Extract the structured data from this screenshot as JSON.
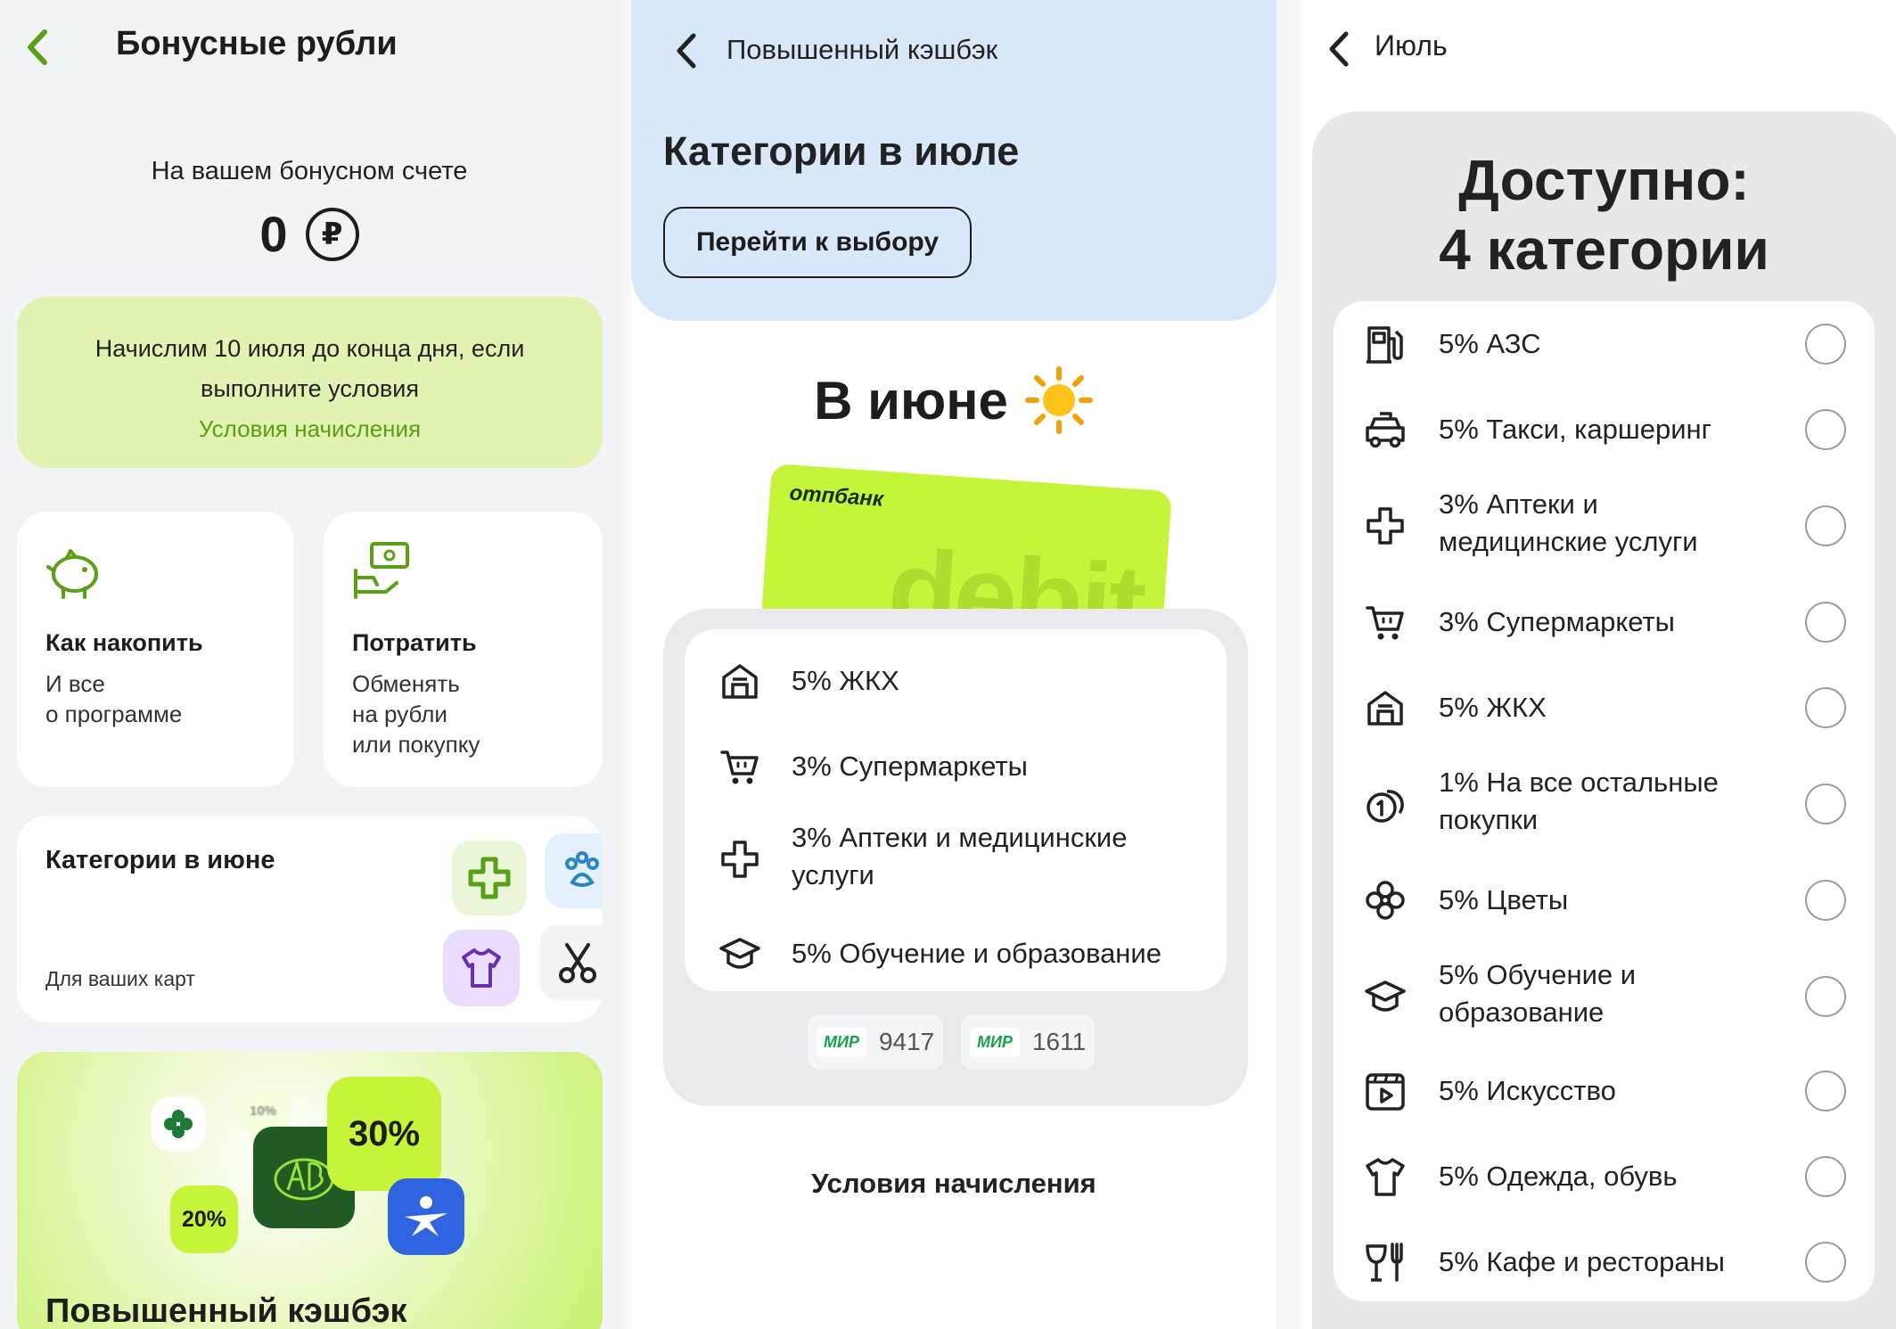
{
  "screen1": {
    "title": "Бонусные рубли",
    "balance_label": "На вашем бонусном счете",
    "balance_value": "0",
    "currency_symbol": "₽",
    "notice_line1": "Начислим 10 июля до конца дня, если",
    "notice_line2": "выполните условия",
    "notice_link": "Условия начисления",
    "card_accumulate": {
      "title": "Как накопить",
      "subtitle": "И все\nо программе",
      "icon": "piggy-bank-icon"
    },
    "card_spend": {
      "title": "Потратить",
      "subtitle": "Обменять\nна рубли\nили покупку",
      "icon": "cash-hand-icon"
    },
    "categories_card": {
      "title": "Категории в июне",
      "subtitle": "Для ваших карт"
    },
    "promo": {
      "badge_30": "30%",
      "badge_20": "20%",
      "badge_10": "10%",
      "title": "Повышенный кэшбэк"
    }
  },
  "screen2": {
    "title": "Повышенный кэшбэк",
    "heading": "Категории в июле",
    "choose_button": "Перейти к выбору",
    "june_title": "В июне",
    "card_brand": "отпбанк",
    "card_word": "debit",
    "june_items": [
      {
        "text": "5% ЖКХ",
        "icon": "house-icon"
      },
      {
        "text": "3% Супермаркеты",
        "icon": "cart-icon"
      },
      {
        "text": "3% Аптеки и медицинские\nуслуги",
        "icon": "cross-icon"
      },
      {
        "text": "5% Обучение и образование",
        "icon": "graduation-cap-icon"
      }
    ],
    "cards": [
      {
        "brand": "МИР",
        "number": "9417"
      },
      {
        "brand": "МИР",
        "number": "1611"
      }
    ],
    "conditions_link": "Условия начисления"
  },
  "screen3": {
    "title": "Июль",
    "available_line1": "Доступно:",
    "available_line2": "4 категории",
    "items": [
      {
        "text": "5% АЗС",
        "icon": "fuel-icon"
      },
      {
        "text": "5% Такси, каршеринг",
        "icon": "taxi-icon"
      },
      {
        "text": "3% Аптеки и\nмедицинские услуги",
        "icon": "cross-icon"
      },
      {
        "text": "3% Супермаркеты",
        "icon": "cart-icon"
      },
      {
        "text": "5% ЖКХ",
        "icon": "house-icon"
      },
      {
        "text": "1% На все остальные\nпокупки",
        "icon": "coins-icon"
      },
      {
        "text": "5% Цветы",
        "icon": "flower-icon"
      },
      {
        "text": "5% Обучение и\nобразование",
        "icon": "graduation-cap-icon"
      },
      {
        "text": "5% Искусство",
        "icon": "art-icon"
      },
      {
        "text": "5% Одежда, обувь",
        "icon": "tshirt-icon"
      },
      {
        "text": "5% Кафе и рестораны",
        "icon": "cafe-icon"
      }
    ]
  },
  "colors": {
    "accent_green": "#5d9e10",
    "notice_bg": "#e1f3b3",
    "header_blue": "#d8e8f8",
    "card_lime": "#c6f43a"
  }
}
